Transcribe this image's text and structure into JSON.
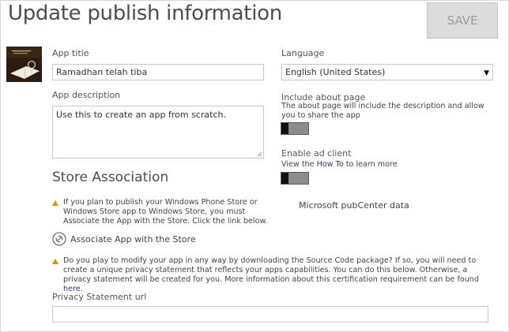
{
  "header": {
    "title": "Update publish information",
    "save_label": "SAVE"
  },
  "app_icon": "app-thumbnail",
  "app_title": {
    "label": "App title",
    "value": "Ramadhan telah tiba"
  },
  "app_description": {
    "label": "App description",
    "value": "Use this to create an app from scratch."
  },
  "language": {
    "label": "Language",
    "selected": "English (United States)"
  },
  "about_page": {
    "label": "Include about page",
    "note": "The about page will include the description and allow you to share the app",
    "enabled": false
  },
  "ad_client": {
    "label": "Enable ad client",
    "note_prefix": "View the ",
    "note_link": "How To",
    "note_suffix": " to learn more",
    "enabled": false,
    "pubcenter_label": "Microsoft pubCenter data"
  },
  "store": {
    "title": "Store Association",
    "warning1": "If you plan to publish your Windows Phone Store or Windows Store app to Windows Store, you must Associate the App with the Store. Click the link below.",
    "associate_label": "Associate App with the Store",
    "warning2_text": "Do you play to modify your app in any way by downloading the Source Code package? If so, you will need to create a unique privacy statement that reflects your apps capabilities. You can do this below. Otherwise, a privacy statement will be created for you. More information about this certification requirement can be found ",
    "warning2_link": "here",
    "warning2_end": "."
  },
  "privacy": {
    "label": "Privacy Statement url",
    "value": ""
  },
  "colors": {
    "warning": "#d99400",
    "link": "#4b2a8a",
    "save_bg": "#dcdcdc"
  }
}
